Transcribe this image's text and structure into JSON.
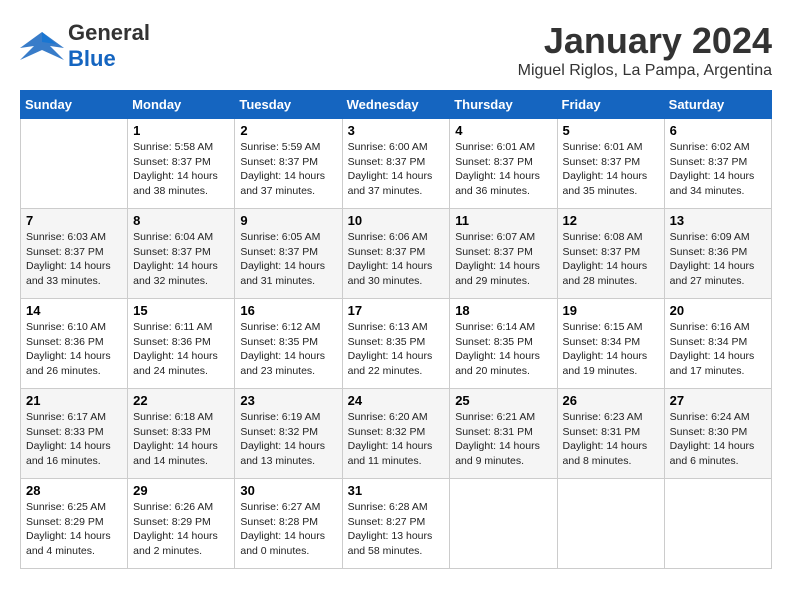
{
  "logo": {
    "general": "General",
    "blue": "Blue"
  },
  "title": "January 2024",
  "subtitle": "Miguel Riglos, La Pampa, Argentina",
  "days_of_week": [
    "Sunday",
    "Monday",
    "Tuesday",
    "Wednesday",
    "Thursday",
    "Friday",
    "Saturday"
  ],
  "weeks": [
    [
      {
        "day": "",
        "info": ""
      },
      {
        "day": "1",
        "info": "Sunrise: 5:58 AM\nSunset: 8:37 PM\nDaylight: 14 hours\nand 38 minutes."
      },
      {
        "day": "2",
        "info": "Sunrise: 5:59 AM\nSunset: 8:37 PM\nDaylight: 14 hours\nand 37 minutes."
      },
      {
        "day": "3",
        "info": "Sunrise: 6:00 AM\nSunset: 8:37 PM\nDaylight: 14 hours\nand 37 minutes."
      },
      {
        "day": "4",
        "info": "Sunrise: 6:01 AM\nSunset: 8:37 PM\nDaylight: 14 hours\nand 36 minutes."
      },
      {
        "day": "5",
        "info": "Sunrise: 6:01 AM\nSunset: 8:37 PM\nDaylight: 14 hours\nand 35 minutes."
      },
      {
        "day": "6",
        "info": "Sunrise: 6:02 AM\nSunset: 8:37 PM\nDaylight: 14 hours\nand 34 minutes."
      }
    ],
    [
      {
        "day": "7",
        "info": "Sunrise: 6:03 AM\nSunset: 8:37 PM\nDaylight: 14 hours\nand 33 minutes."
      },
      {
        "day": "8",
        "info": "Sunrise: 6:04 AM\nSunset: 8:37 PM\nDaylight: 14 hours\nand 32 minutes."
      },
      {
        "day": "9",
        "info": "Sunrise: 6:05 AM\nSunset: 8:37 PM\nDaylight: 14 hours\nand 31 minutes."
      },
      {
        "day": "10",
        "info": "Sunrise: 6:06 AM\nSunset: 8:37 PM\nDaylight: 14 hours\nand 30 minutes."
      },
      {
        "day": "11",
        "info": "Sunrise: 6:07 AM\nSunset: 8:37 PM\nDaylight: 14 hours\nand 29 minutes."
      },
      {
        "day": "12",
        "info": "Sunrise: 6:08 AM\nSunset: 8:37 PM\nDaylight: 14 hours\nand 28 minutes."
      },
      {
        "day": "13",
        "info": "Sunrise: 6:09 AM\nSunset: 8:36 PM\nDaylight: 14 hours\nand 27 minutes."
      }
    ],
    [
      {
        "day": "14",
        "info": "Sunrise: 6:10 AM\nSunset: 8:36 PM\nDaylight: 14 hours\nand 26 minutes."
      },
      {
        "day": "15",
        "info": "Sunrise: 6:11 AM\nSunset: 8:36 PM\nDaylight: 14 hours\nand 24 minutes."
      },
      {
        "day": "16",
        "info": "Sunrise: 6:12 AM\nSunset: 8:35 PM\nDaylight: 14 hours\nand 23 minutes."
      },
      {
        "day": "17",
        "info": "Sunrise: 6:13 AM\nSunset: 8:35 PM\nDaylight: 14 hours\nand 22 minutes."
      },
      {
        "day": "18",
        "info": "Sunrise: 6:14 AM\nSunset: 8:35 PM\nDaylight: 14 hours\nand 20 minutes."
      },
      {
        "day": "19",
        "info": "Sunrise: 6:15 AM\nSunset: 8:34 PM\nDaylight: 14 hours\nand 19 minutes."
      },
      {
        "day": "20",
        "info": "Sunrise: 6:16 AM\nSunset: 8:34 PM\nDaylight: 14 hours\nand 17 minutes."
      }
    ],
    [
      {
        "day": "21",
        "info": "Sunrise: 6:17 AM\nSunset: 8:33 PM\nDaylight: 14 hours\nand 16 minutes."
      },
      {
        "day": "22",
        "info": "Sunrise: 6:18 AM\nSunset: 8:33 PM\nDaylight: 14 hours\nand 14 minutes."
      },
      {
        "day": "23",
        "info": "Sunrise: 6:19 AM\nSunset: 8:32 PM\nDaylight: 14 hours\nand 13 minutes."
      },
      {
        "day": "24",
        "info": "Sunrise: 6:20 AM\nSunset: 8:32 PM\nDaylight: 14 hours\nand 11 minutes."
      },
      {
        "day": "25",
        "info": "Sunrise: 6:21 AM\nSunset: 8:31 PM\nDaylight: 14 hours\nand 9 minutes."
      },
      {
        "day": "26",
        "info": "Sunrise: 6:23 AM\nSunset: 8:31 PM\nDaylight: 14 hours\nand 8 minutes."
      },
      {
        "day": "27",
        "info": "Sunrise: 6:24 AM\nSunset: 8:30 PM\nDaylight: 14 hours\nand 6 minutes."
      }
    ],
    [
      {
        "day": "28",
        "info": "Sunrise: 6:25 AM\nSunset: 8:29 PM\nDaylight: 14 hours\nand 4 minutes."
      },
      {
        "day": "29",
        "info": "Sunrise: 6:26 AM\nSunset: 8:29 PM\nDaylight: 14 hours\nand 2 minutes."
      },
      {
        "day": "30",
        "info": "Sunrise: 6:27 AM\nSunset: 8:28 PM\nDaylight: 14 hours\nand 0 minutes."
      },
      {
        "day": "31",
        "info": "Sunrise: 6:28 AM\nSunset: 8:27 PM\nDaylight: 13 hours\nand 58 minutes."
      },
      {
        "day": "",
        "info": ""
      },
      {
        "day": "",
        "info": ""
      },
      {
        "day": "",
        "info": ""
      }
    ]
  ]
}
